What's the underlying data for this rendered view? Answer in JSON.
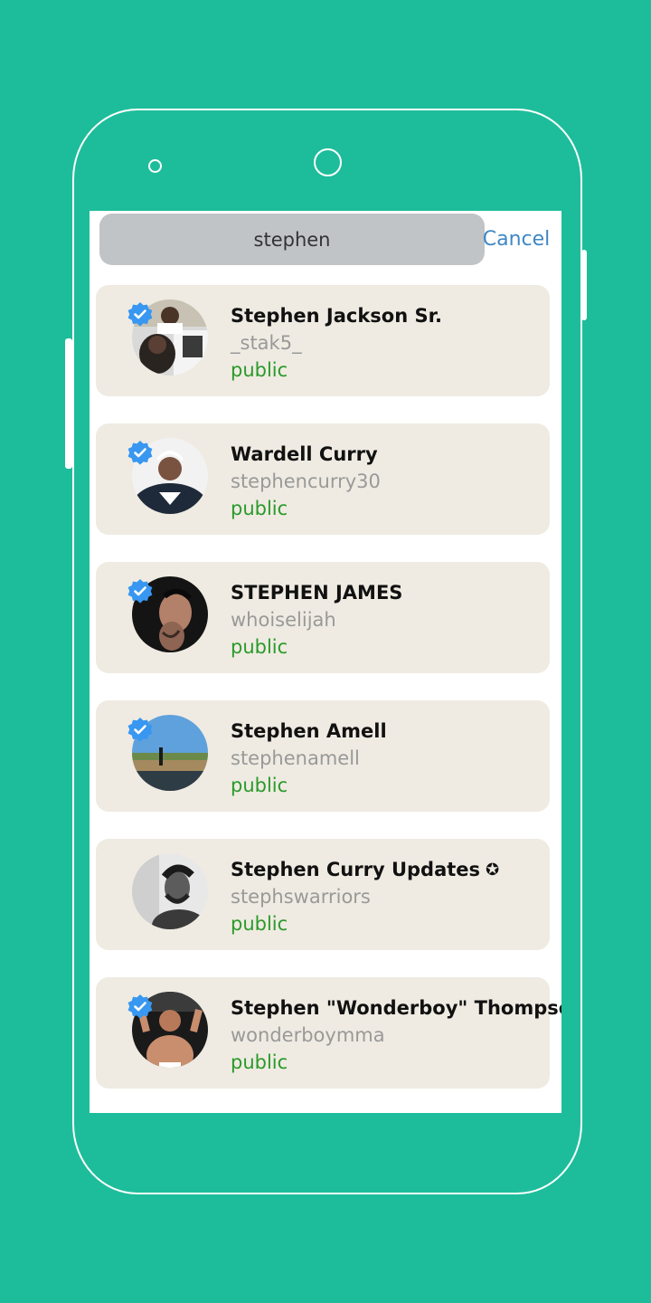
{
  "search": {
    "query": "stephen",
    "cancel_label": "Cancel"
  },
  "colors": {
    "background": "#1dbd9b",
    "card": "#efebe2",
    "cancel": "#3f88c5",
    "public": "#2a9a2a",
    "verified": "#3897f0"
  },
  "results": [
    {
      "name": "Stephen Jackson Sr.",
      "username": "_stak5_",
      "privacy": "public",
      "verified": true
    },
    {
      "name": "Wardell Curry",
      "username": "stephencurry30",
      "privacy": "public",
      "verified": true
    },
    {
      "name": "STEPHEN JAMES",
      "username": "whoiselijah",
      "privacy": "public",
      "verified": true
    },
    {
      "name": "Stephen Amell",
      "username": "stephenamell",
      "privacy": "public",
      "verified": true
    },
    {
      "name": "Stephen Curry Updates",
      "username": "stephswarriors",
      "privacy": "public",
      "verified": false,
      "badge": "✪"
    },
    {
      "name": "Stephen \"Wonderboy\" Thompson",
      "username": "wonderboymma",
      "privacy": "public",
      "verified": true
    }
  ]
}
